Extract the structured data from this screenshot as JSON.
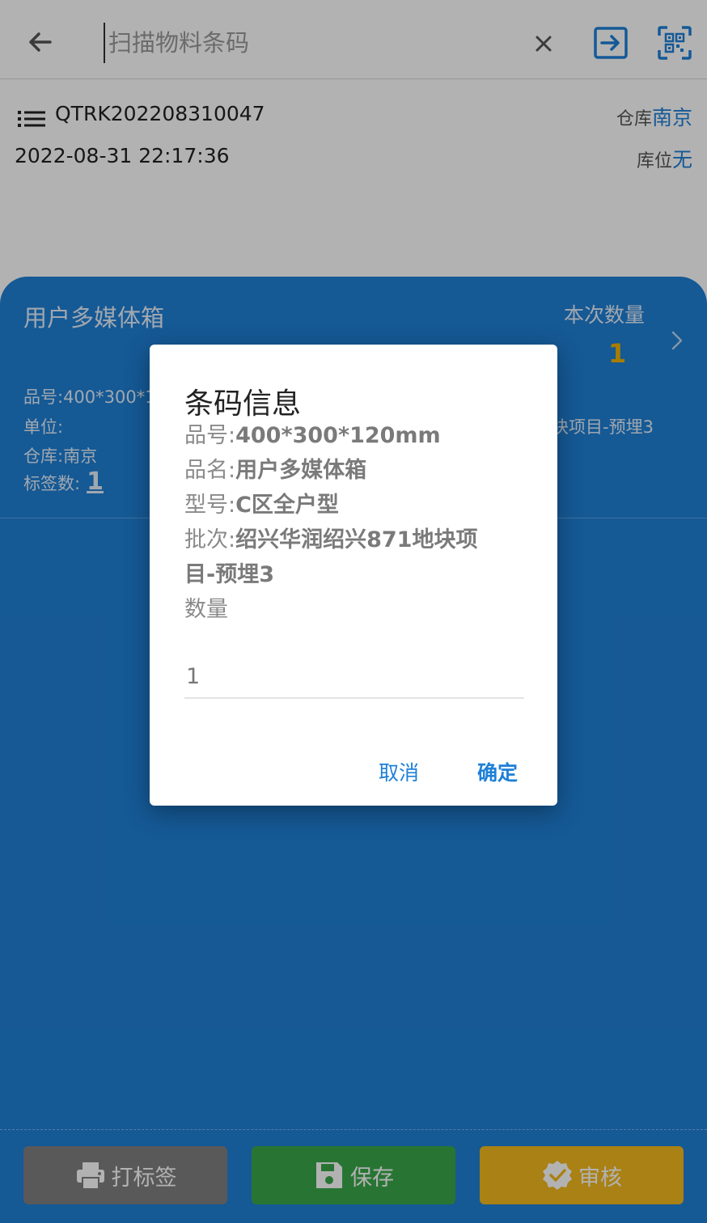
{
  "search": {
    "placeholder": "扫描物料条码",
    "value": ""
  },
  "header": {
    "doc_no": "QTRK202208310047",
    "doc_time": "2022-08-31 22:17:36",
    "warehouse_label": "仓库",
    "warehouse_value": "南京",
    "location_label": "库位",
    "location_value": "无"
  },
  "card": {
    "item_name": "用户多媒体箱",
    "qty_title": "本次数量",
    "qty_value": "1",
    "part_no_line": "品号:400*300*1",
    "unit_line": "单位:",
    "warehouse_line": "仓库:南京",
    "label_count_label": "标签数:",
    "label_count_value": "1",
    "batch_tail": "块项目-预埋3"
  },
  "buttons": {
    "print": "打标签",
    "save": "保存",
    "audit": "审核"
  },
  "dialog": {
    "title": "条码信息",
    "part_no_label": "品号:",
    "part_no": "400*300*120mm",
    "name_label": "品名:",
    "name": "用户多媒体箱",
    "model_label": "型号:",
    "model": "C区全户型",
    "batch_label": "批次:",
    "batch": "绍兴华润绍兴871地块项目-预埋3",
    "qty_label": "数量",
    "qty_value": "1",
    "cancel": "取消",
    "confirm": "确定"
  },
  "colors": {
    "accent": "#1e80d8",
    "panel": "#1f80d6",
    "print_button": "#808080",
    "save_button": "#3aa84a",
    "audit_button": "#f3b91e",
    "qty_highlight": "#f0b400"
  },
  "icons": [
    "arrow-left-icon",
    "clear-icon",
    "enter-icon",
    "qr-scan-icon",
    "list-icon",
    "chevron-right-icon",
    "printer-icon",
    "save-icon",
    "verified-badge-icon"
  ]
}
